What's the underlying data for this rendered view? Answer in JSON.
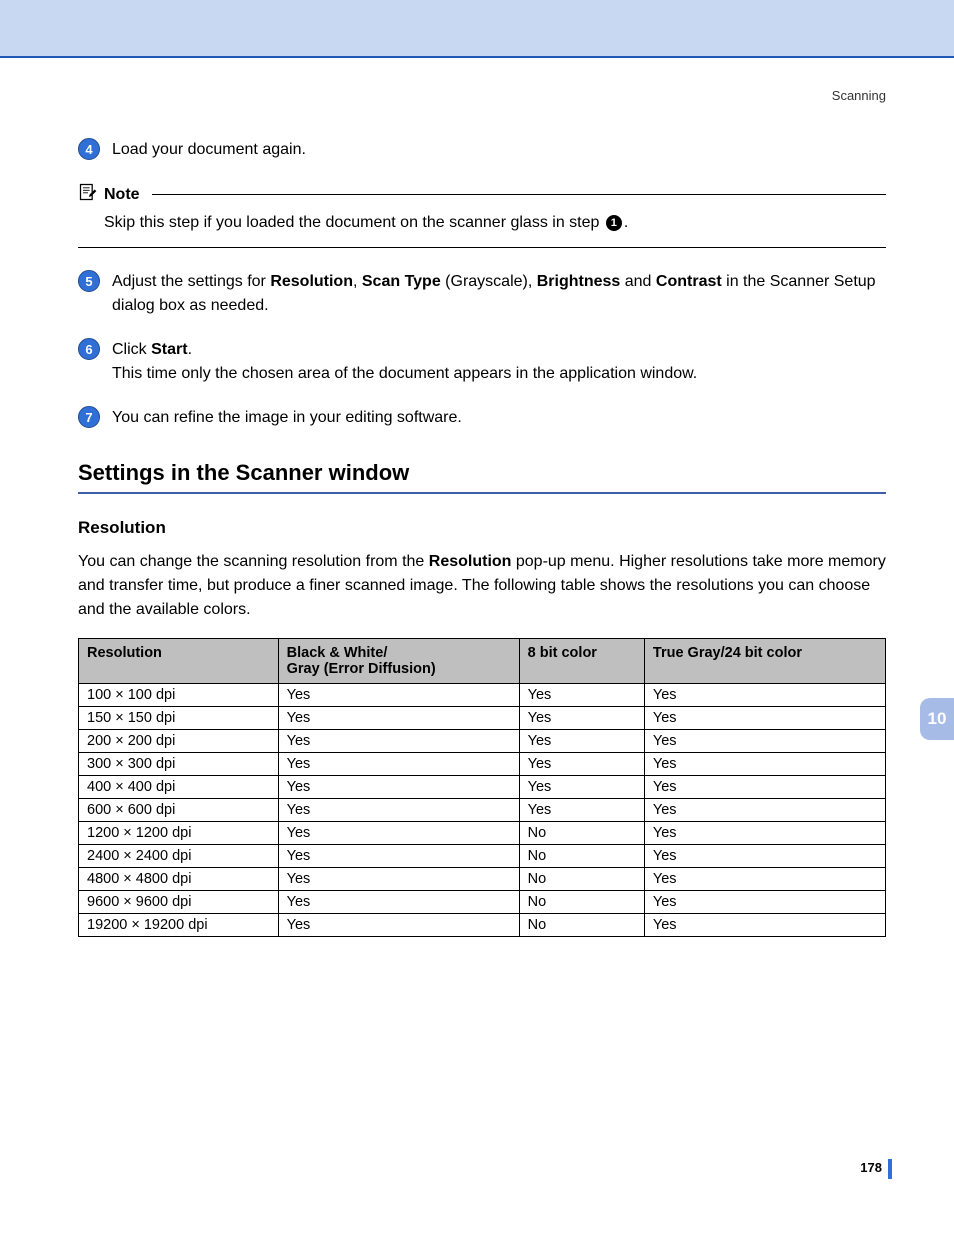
{
  "header": {
    "section": "Scanning"
  },
  "tab": {
    "number": "10"
  },
  "page_number": "178",
  "steps": {
    "s4": {
      "num": "4",
      "text": "Load your document again."
    },
    "s5": {
      "num": "5",
      "pre": "Adjust the settings for ",
      "b1": "Resolution",
      "c1": ", ",
      "b2": "Scan Type",
      "c2": " (Grayscale), ",
      "b3": "Brightness",
      "c3": " and ",
      "b4": "Contrast",
      "post": " in the Scanner Setup dialog box as needed."
    },
    "s6": {
      "num": "6",
      "line1_pre": "Click ",
      "line1_b": "Start",
      "line1_post": ".",
      "line2": "This time only the chosen area of the document appears in the application window."
    },
    "s7": {
      "num": "7",
      "text": "You can refine the image in your editing software."
    }
  },
  "note": {
    "label": "Note",
    "body_pre": "Skip this step if you loaded the document on the scanner glass in step ",
    "ref": "1",
    "body_post": "."
  },
  "section": {
    "title": "Settings in the Scanner window"
  },
  "subsection": {
    "title": "Resolution"
  },
  "paragraph": {
    "pre": "You can change the scanning resolution from the ",
    "b": "Resolution",
    "post": " pop-up menu. Higher resolutions take more memory and transfer time, but produce a finer scanned image. The following table shows the resolutions you can choose and the available colors."
  },
  "chart_data": {
    "type": "table",
    "headers": [
      "Resolution",
      "Black & White/\nGray (Error Diffusion)",
      "8 bit color",
      "True Gray/24 bit color"
    ],
    "rows": [
      [
        "100 × 100 dpi",
        "Yes",
        "Yes",
        "Yes"
      ],
      [
        "150 × 150 dpi",
        "Yes",
        "Yes",
        "Yes"
      ],
      [
        "200 × 200 dpi",
        "Yes",
        "Yes",
        "Yes"
      ],
      [
        "300 × 300 dpi",
        "Yes",
        "Yes",
        "Yes"
      ],
      [
        "400 × 400 dpi",
        "Yes",
        "Yes",
        "Yes"
      ],
      [
        "600 × 600 dpi",
        "Yes",
        "Yes",
        "Yes"
      ],
      [
        "1200 × 1200 dpi",
        "Yes",
        "No",
        "Yes"
      ],
      [
        "2400 × 2400 dpi",
        "Yes",
        "No",
        "Yes"
      ],
      [
        "4800 × 4800 dpi",
        "Yes",
        "No",
        "Yes"
      ],
      [
        "9600 × 9600 dpi",
        "Yes",
        "No",
        "Yes"
      ],
      [
        "19200 × 19200 dpi",
        "Yes",
        "No",
        "Yes"
      ]
    ]
  }
}
